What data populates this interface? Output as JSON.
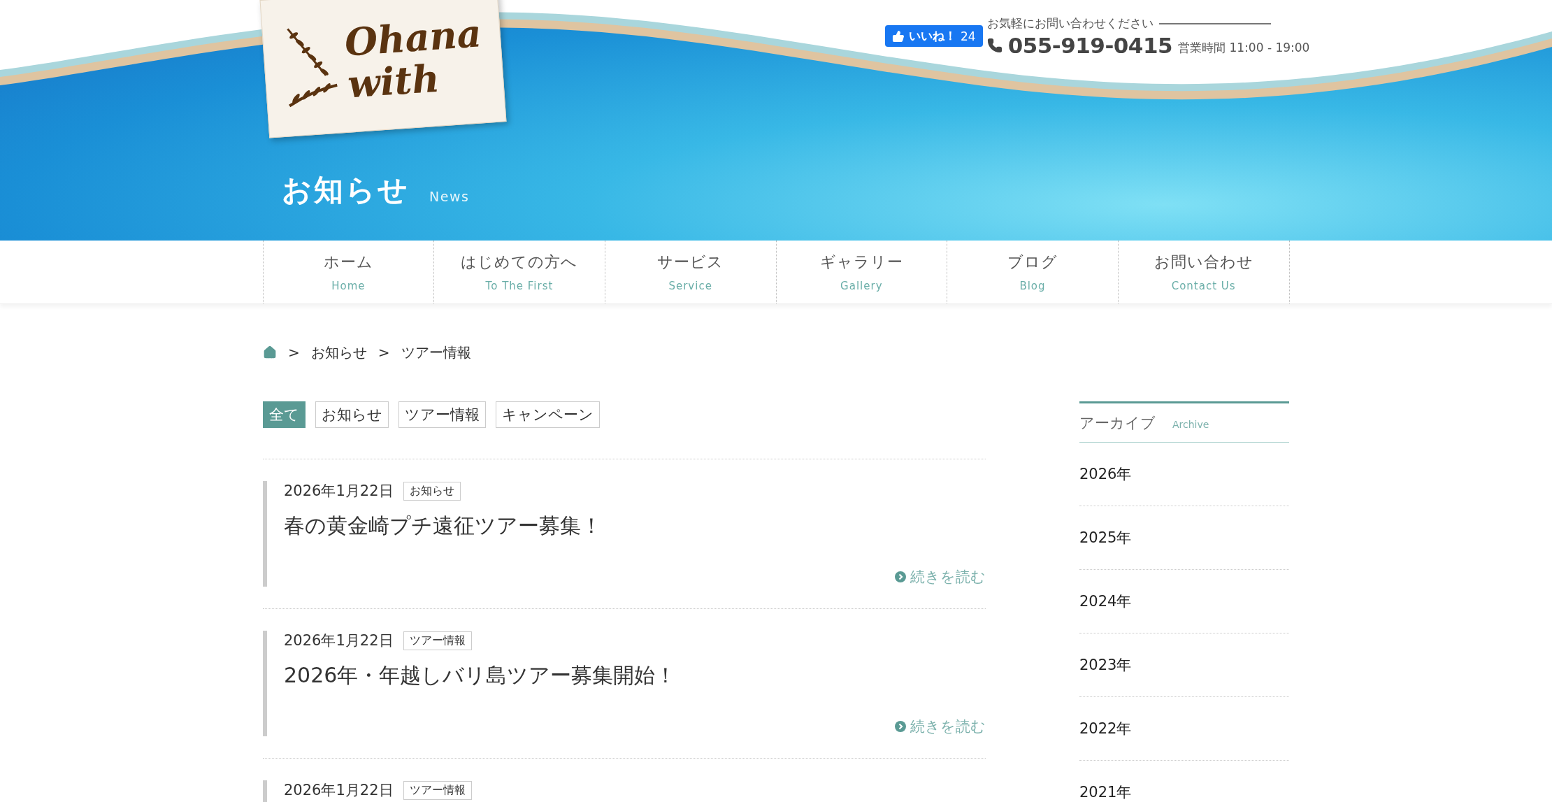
{
  "header": {
    "logo": {
      "lines": [
        "Ohana",
        "with"
      ]
    },
    "like": {
      "label": "いいね！",
      "count": "24"
    },
    "contact": {
      "prompt": "お気軽にお問い合わせください",
      "phone": "055-919-0415",
      "hours": "営業時間 11:00 - 19:00"
    },
    "title": "お知らせ",
    "subtitle": "News"
  },
  "nav": [
    {
      "label": "ホーム",
      "sub": "Home"
    },
    {
      "label": "はじめての方へ",
      "sub": "To The First"
    },
    {
      "label": "サービス",
      "sub": "Service"
    },
    {
      "label": "ギャラリー",
      "sub": "Gallery"
    },
    {
      "label": "ブログ",
      "sub": "Blog"
    },
    {
      "label": "お問い合わせ",
      "sub": "Contact Us"
    }
  ],
  "breadcrumb": {
    "separator": ">",
    "items": [
      "お知らせ",
      "ツアー情報"
    ]
  },
  "filters": [
    {
      "label": "全て",
      "selected": true
    },
    {
      "label": "お知らせ",
      "selected": false
    },
    {
      "label": "ツアー情報",
      "selected": false
    },
    {
      "label": "キャンペーン",
      "selected": false
    }
  ],
  "posts": [
    {
      "date": "2026年1月22日",
      "category": "お知らせ",
      "title": "春の黄金崎プチ遠征ツアー募集！",
      "more": "続きを読む"
    },
    {
      "date": "2026年1月22日",
      "category": "ツアー情報",
      "title": "2026年・年越しバリ島ツアー募集開始！",
      "more": "続きを読む"
    },
    {
      "date": "2026年1月22日",
      "category": "ツアー情報"
    }
  ],
  "archive": {
    "title": "アーカイブ",
    "subtitle": "Archive",
    "years": [
      "2026年",
      "2025年",
      "2024年",
      "2023年",
      "2022年",
      "2021年"
    ]
  }
}
